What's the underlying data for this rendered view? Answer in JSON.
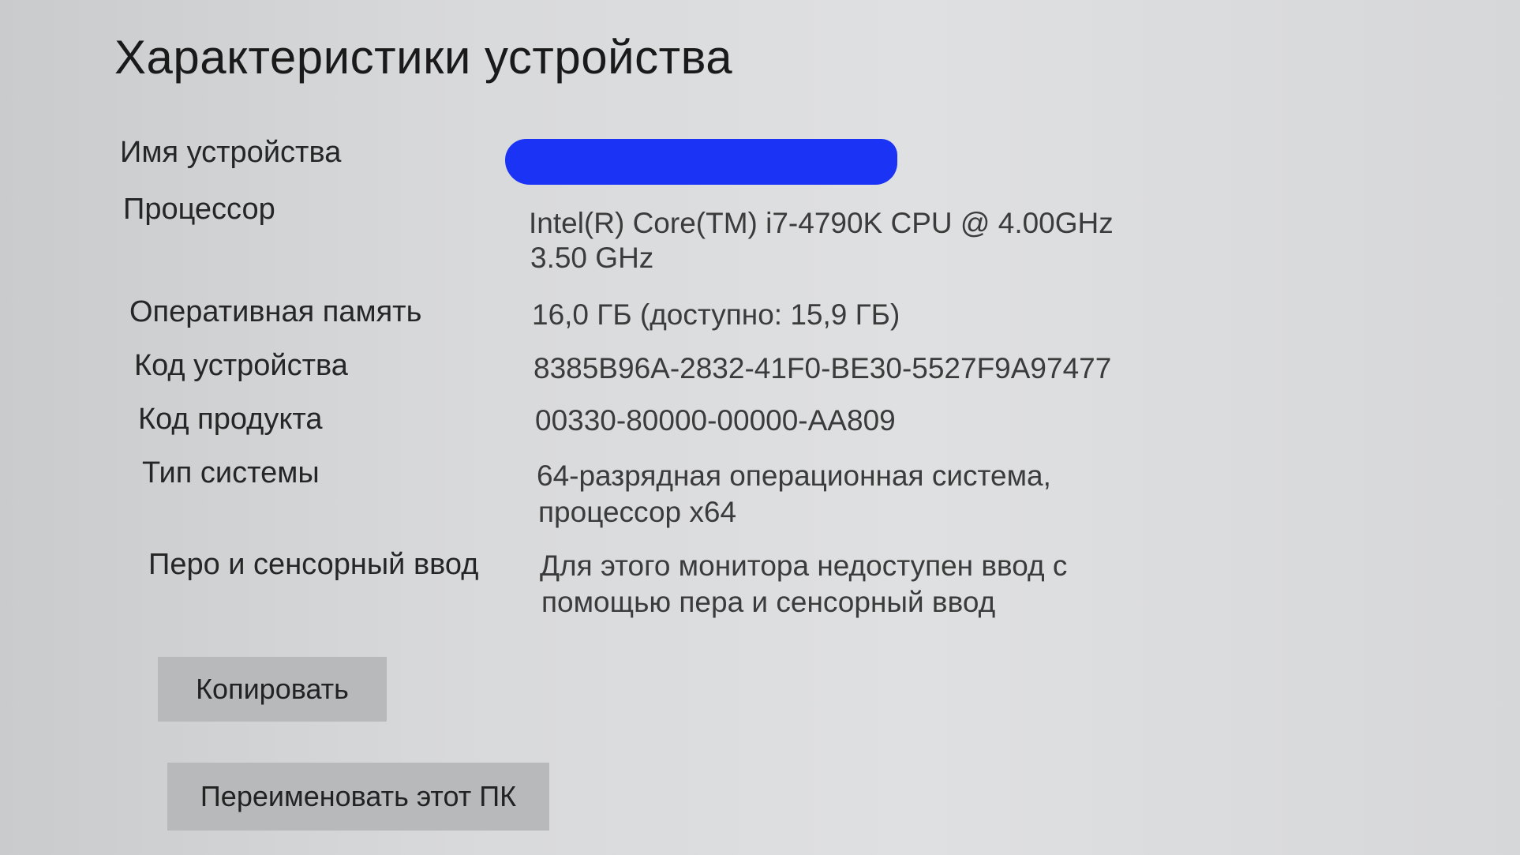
{
  "title": "Характеристики устройства",
  "specs": {
    "device_name": {
      "label": "Имя устройства",
      "value": ""
    },
    "processor": {
      "label": "Процессор",
      "value_line1": "Intel(R) Core(TM) i7-4790K CPU @ 4.00GHz",
      "value_line2": "3.50 GHz"
    },
    "ram": {
      "label": "Оперативная память",
      "value": "16,0 ГБ (доступно: 15,9 ГБ)"
    },
    "device_id": {
      "label": "Код устройства",
      "value": "8385B96A-2832-41F0-BE30-5527F9A97477"
    },
    "product_id": {
      "label": "Код продукта",
      "value": "00330-80000-00000-AA809"
    },
    "system_type": {
      "label": "Тип системы",
      "value_line1": "64-разрядная операционная система,",
      "value_line2": "процессор x64"
    },
    "pen_touch": {
      "label": "Перо и сенсорный ввод",
      "value_line1": "Для этого монитора недоступен ввод с",
      "value_line2": "помощью пера и сенсорный ввод"
    }
  },
  "buttons": {
    "copy": "Копировать",
    "rename": "Переименовать этот ПК"
  },
  "colors": {
    "redaction": "#1a33f5",
    "button_bg": "#b8b9ba"
  }
}
